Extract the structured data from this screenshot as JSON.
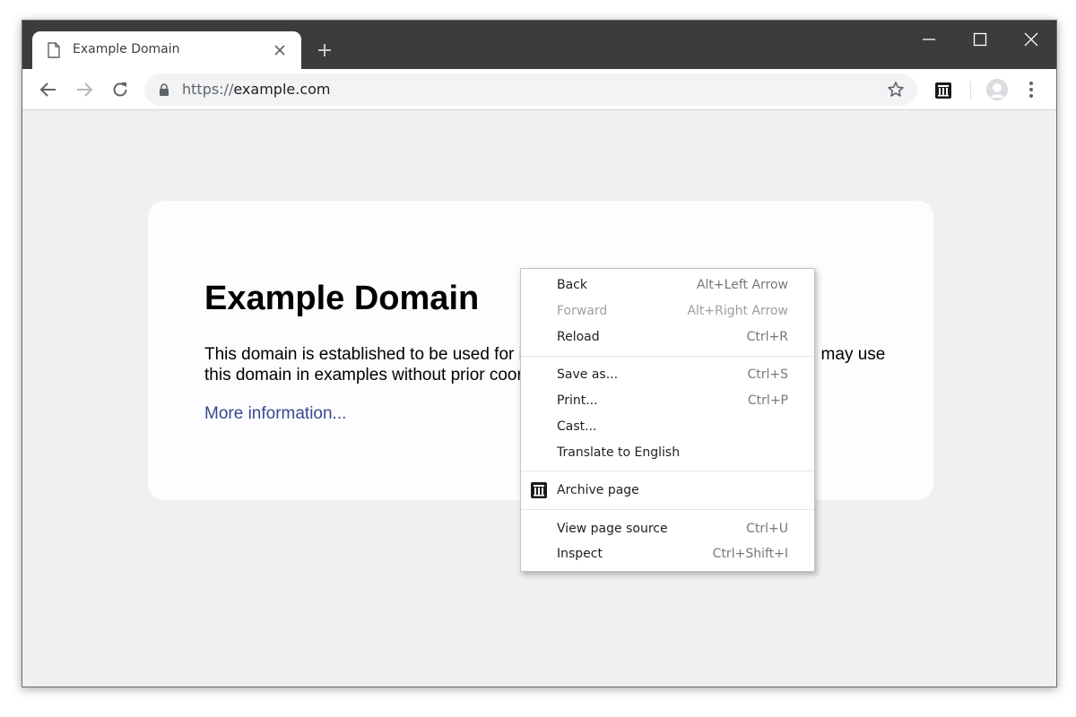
{
  "tab": {
    "title": "Example Domain",
    "icon": "document-icon"
  },
  "toolbar": {
    "url_scheme": "https://",
    "url_host": "example.com",
    "icons": [
      "back-arrow-icon",
      "forward-arrow-icon",
      "reload-icon",
      "lock-icon",
      "star-icon",
      "archive-icon",
      "avatar-icon",
      "more-vert-icon"
    ]
  },
  "page": {
    "heading": "Example Domain",
    "paragraph": "This domain is established to be used for illustrative examples in documents. You may use this domain in examples without prior coordination or asking for permission.",
    "link": "More information..."
  },
  "context_menu": {
    "items": [
      {
        "label": "Back",
        "shortcut": "Alt+Left Arrow"
      },
      {
        "label": "Forward",
        "shortcut": "Alt+Right Arrow",
        "disabled": true
      },
      {
        "label": "Reload",
        "shortcut": "Ctrl+R"
      },
      {
        "label": "Save as...",
        "shortcut": "Ctrl+S"
      },
      {
        "label": "Print...",
        "shortcut": "Ctrl+P"
      },
      {
        "label": "Cast...",
        "shortcut": ""
      },
      {
        "label": "Translate to English",
        "shortcut": ""
      },
      {
        "label": "Archive page",
        "shortcut": "",
        "icon": "archive-icon"
      },
      {
        "label": "View page source",
        "shortcut": "Ctrl+U"
      },
      {
        "label": "Inspect",
        "shortcut": "Ctrl+Shift+I"
      }
    ]
  },
  "colors": {
    "tabstrip": "#3c3c3c",
    "page_bg": "#f0f0f2",
    "link": "#38488f"
  }
}
